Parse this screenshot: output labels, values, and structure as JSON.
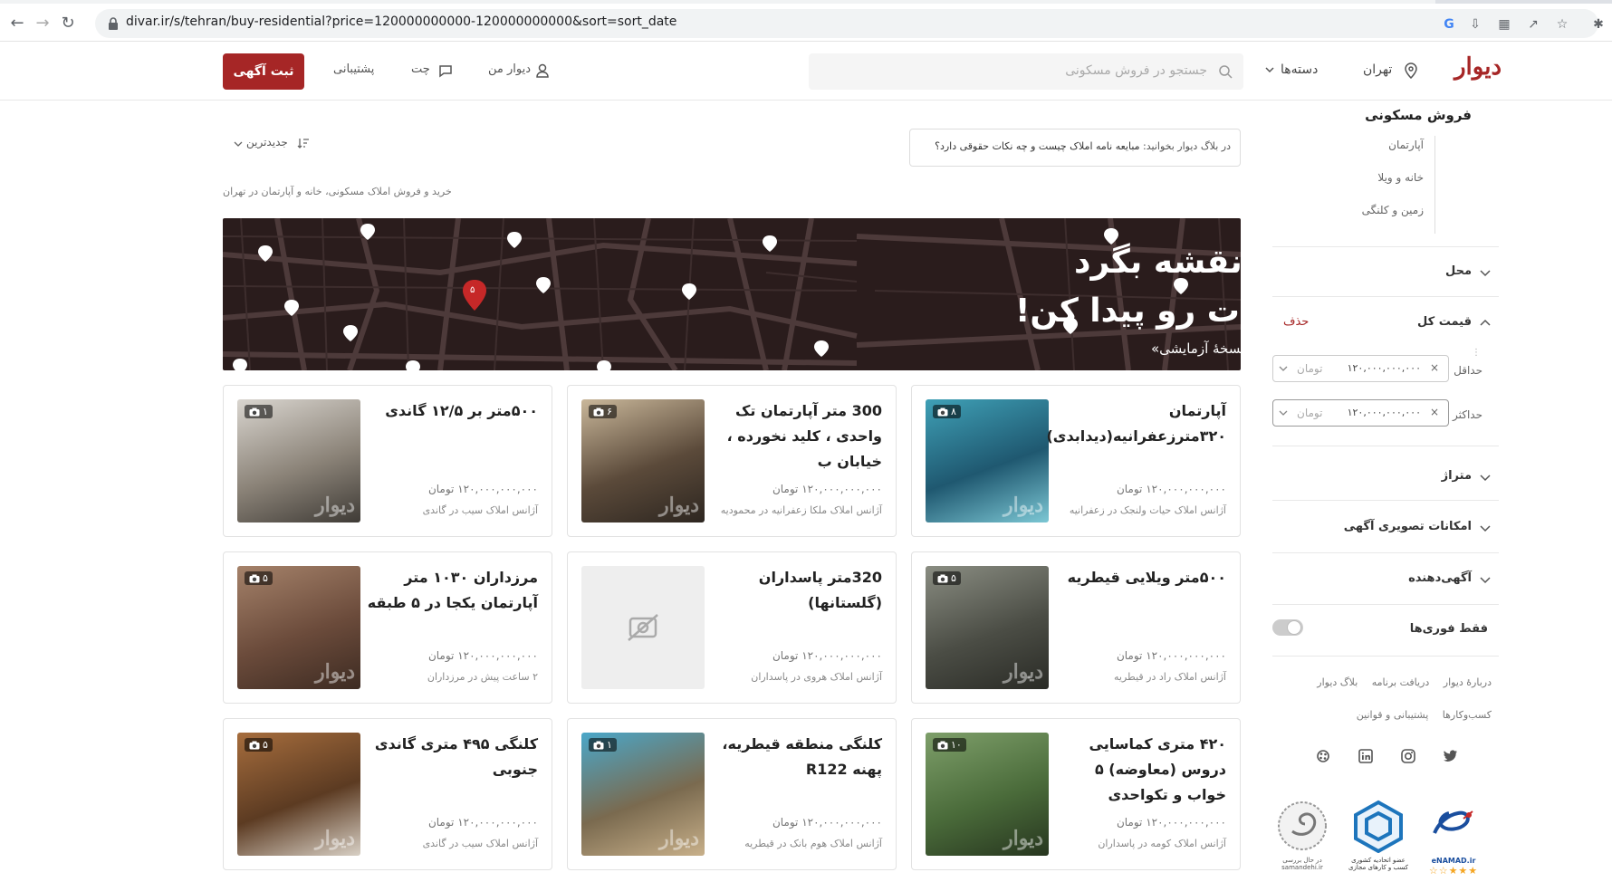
{
  "browser": {
    "url": "divar.ir/s/tehran/buy-residential?price=120000000000-120000000000&sort=sort_date"
  },
  "header": {
    "logo": "دیوار",
    "city": "تهران",
    "categories": "دسته‌ها",
    "search_placeholder": "جستجو در فروش مسکونی",
    "my_divar": "دیوار من",
    "chat": "چت",
    "support": "پشتیبانی",
    "post_ad": "ثبت آگهی",
    "brand_color": "#a62626"
  },
  "sidebar": {
    "title": "فروش مسکونی",
    "subcategories": [
      "آپارتمان",
      "خانه و ویلا",
      "زمین و کلنگی"
    ],
    "filters": {
      "location": "محل",
      "total_price": "قیمت کل",
      "delete": "حذف",
      "min_label": "حداقل",
      "max_label": "حداکثر",
      "min_value": "۱۲۰,۰۰۰,۰۰۰,۰۰۰",
      "max_value": "۱۲۰,۰۰۰,۰۰۰,۰۰۰",
      "unit": "تومان",
      "area": "متراژ",
      "image_features": "امکانات تصویری آگهی",
      "advertiser": "آگهی‌دهنده",
      "instant_only": "فقط فوری‌ها",
      "instant_enabled": false
    },
    "footer_links_row1": [
      "دربارهٔ دیوار",
      "دریافت برنامه",
      "بلاگ دیوار"
    ],
    "footer_links_row2": [
      "کسب‌وکارها",
      "پشتیبانی و قوانین"
    ],
    "badges": {
      "enamad": "eNAMAD.ir",
      "union": "عضو اتحادیه کشوری",
      "union_sub": "کسب و کارهای مجازی",
      "samandehi": "samandehi.ir",
      "samandehi_sub": "در حال بررسی"
    }
  },
  "main": {
    "blog_prefix": "در بلاگ دیوار بخوانید:",
    "blog_title": "مبایعه نامه املاک چیست و چه نکات حقوقی دارد؟",
    "sort_label": "جدیدترین",
    "breadcrumb": "خرید و فروش املاک مسکونی، خانه و آپارتمان در تهران",
    "banner": {
      "line1": "روی نقشه بگرد",
      "line2": "خونه‌ات رو پیدا کن!",
      "line3": "«نسخهٔ آزمایشی»",
      "marker_count": "۵"
    },
    "cards": [
      {
        "title": "آپارتمان ۳۲۰مترزعفرانیه(دیدابدی)",
        "price": "۱۲۰,۰۰۰,۰۰۰,۰۰۰ تومان",
        "meta": "آژانس املاک حیات ولنجک در زعفرانیه",
        "photos": "۸"
      },
      {
        "title": "300 متر آپارتمان تک واحدی ، کلید نخورده ، خیابان ب",
        "price": "۱۲۰,۰۰۰,۰۰۰,۰۰۰ تومان",
        "meta": "آژانس املاک ملکا زعفرانیه در محمودیه",
        "photos": "۶"
      },
      {
        "title": "۵۰۰متر بر ۱۲/۵ گاندی",
        "price": "۱۲۰,۰۰۰,۰۰۰,۰۰۰ تومان",
        "meta": "آژانس املاک سیب در گاندی",
        "photos": "۱"
      },
      {
        "title": "۵۰۰متر ویلایی قیطریه",
        "price": "۱۲۰,۰۰۰,۰۰۰,۰۰۰ تومان",
        "meta": "آژانس املاک راد در قیطریه",
        "photos": "۵"
      },
      {
        "title": "320متر پاسداران (گلستانها)",
        "price": "۱۲۰,۰۰۰,۰۰۰,۰۰۰ تومان",
        "meta": "آژانس املاک هروی در پاسداران",
        "photos": ""
      },
      {
        "title": "مرزداران ۱۰۳۰ متر آپارتمان یکجا در ۵ طبقه",
        "price": "۱۲۰,۰۰۰,۰۰۰,۰۰۰ تومان",
        "meta": "۲ ساعت پیش در مرزداران",
        "photos": "۵"
      },
      {
        "title": "۴۲۰ متری کماسایی دروس (معاوضه) ۵ خواب و تکواحدی",
        "price": "۱۲۰,۰۰۰,۰۰۰,۰۰۰ تومان",
        "meta": "آژانس املاک کومه در پاسداران",
        "photos": "۱۰"
      },
      {
        "title": "کلنگی منطقه قیطریه، پهنه R122",
        "price": "۱۲۰,۰۰۰,۰۰۰,۰۰۰ تومان",
        "meta": "آژانس املاک هوم بانک در قیطریه",
        "photos": "۱"
      },
      {
        "title": "کلنگی ۴۹۵ متری گاندی جنوبی",
        "price": "۱۲۰,۰۰۰,۰۰۰,۰۰۰ تومان",
        "meta": "آژانس املاک سیب در گاندی",
        "photos": "۵"
      }
    ],
    "watermark": "دیوار"
  }
}
